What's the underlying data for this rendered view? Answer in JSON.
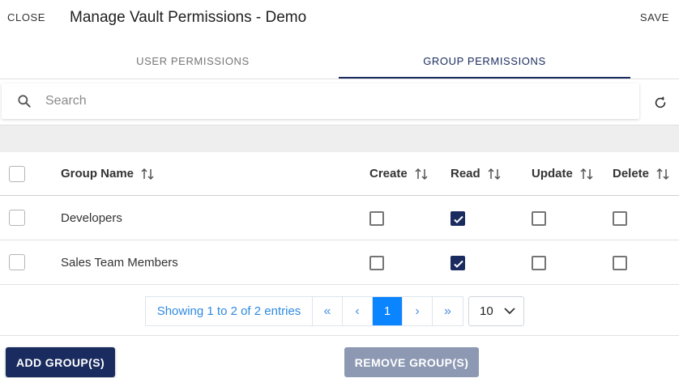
{
  "header": {
    "close_label": "CLOSE",
    "title": "Manage Vault Permissions - Demo",
    "save_label": "SAVE"
  },
  "tabs": [
    {
      "label": "USER PERMISSIONS",
      "active": false
    },
    {
      "label": "GROUP PERMISSIONS",
      "active": true
    }
  ],
  "search": {
    "placeholder": "Search",
    "value": ""
  },
  "icons": {
    "search": "search-icon",
    "refresh": "refresh-icon",
    "sort": "sort-icon",
    "check": "check-icon",
    "chevron": "chevron-down-icon"
  },
  "table": {
    "columns": [
      "Group Name",
      "Create",
      "Read",
      "Update",
      "Delete"
    ],
    "rows": [
      {
        "name": "Developers",
        "selected": false,
        "create": false,
        "read": true,
        "update": false,
        "delete": false
      },
      {
        "name": "Sales Team Members",
        "selected": false,
        "create": false,
        "read": true,
        "update": false,
        "delete": false
      }
    ]
  },
  "pagination": {
    "info": "Showing 1 to 2 of 2 entries",
    "first": "«",
    "prev": "‹",
    "current_page": "1",
    "next": "›",
    "last": "»",
    "page_size": "10"
  },
  "footer": {
    "add_label": "ADD GROUP(S)",
    "remove_label": "REMOVE GROUP(S)"
  },
  "colors": {
    "primary": "#1a2b5f",
    "link": "#2f8ae0",
    "active_page": "#0a84ff",
    "disabled_button": "#8d99b3"
  }
}
